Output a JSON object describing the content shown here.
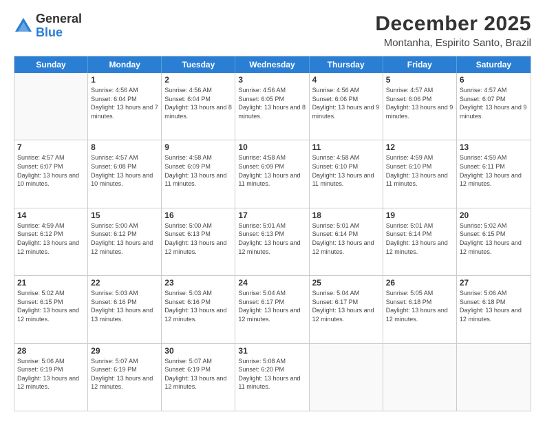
{
  "logo": {
    "general": "General",
    "blue": "Blue"
  },
  "header": {
    "month_year": "December 2025",
    "location": "Montanha, Espirito Santo, Brazil"
  },
  "weekdays": [
    "Sunday",
    "Monday",
    "Tuesday",
    "Wednesday",
    "Thursday",
    "Friday",
    "Saturday"
  ],
  "weeks": [
    [
      {
        "day": "",
        "sunrise": "",
        "sunset": "",
        "daylight": "",
        "empty": true
      },
      {
        "day": "1",
        "sunrise": "Sunrise: 4:56 AM",
        "sunset": "Sunset: 6:04 PM",
        "daylight": "Daylight: 13 hours and 7 minutes."
      },
      {
        "day": "2",
        "sunrise": "Sunrise: 4:56 AM",
        "sunset": "Sunset: 6:04 PM",
        "daylight": "Daylight: 13 hours and 8 minutes."
      },
      {
        "day": "3",
        "sunrise": "Sunrise: 4:56 AM",
        "sunset": "Sunset: 6:05 PM",
        "daylight": "Daylight: 13 hours and 8 minutes."
      },
      {
        "day": "4",
        "sunrise": "Sunrise: 4:56 AM",
        "sunset": "Sunset: 6:06 PM",
        "daylight": "Daylight: 13 hours and 9 minutes."
      },
      {
        "day": "5",
        "sunrise": "Sunrise: 4:57 AM",
        "sunset": "Sunset: 6:06 PM",
        "daylight": "Daylight: 13 hours and 9 minutes."
      },
      {
        "day": "6",
        "sunrise": "Sunrise: 4:57 AM",
        "sunset": "Sunset: 6:07 PM",
        "daylight": "Daylight: 13 hours and 9 minutes."
      }
    ],
    [
      {
        "day": "7",
        "sunrise": "Sunrise: 4:57 AM",
        "sunset": "Sunset: 6:07 PM",
        "daylight": "Daylight: 13 hours and 10 minutes."
      },
      {
        "day": "8",
        "sunrise": "Sunrise: 4:57 AM",
        "sunset": "Sunset: 6:08 PM",
        "daylight": "Daylight: 13 hours and 10 minutes."
      },
      {
        "day": "9",
        "sunrise": "Sunrise: 4:58 AM",
        "sunset": "Sunset: 6:09 PM",
        "daylight": "Daylight: 13 hours and 11 minutes."
      },
      {
        "day": "10",
        "sunrise": "Sunrise: 4:58 AM",
        "sunset": "Sunset: 6:09 PM",
        "daylight": "Daylight: 13 hours and 11 minutes."
      },
      {
        "day": "11",
        "sunrise": "Sunrise: 4:58 AM",
        "sunset": "Sunset: 6:10 PM",
        "daylight": "Daylight: 13 hours and 11 minutes."
      },
      {
        "day": "12",
        "sunrise": "Sunrise: 4:59 AM",
        "sunset": "Sunset: 6:10 PM",
        "daylight": "Daylight: 13 hours and 11 minutes."
      },
      {
        "day": "13",
        "sunrise": "Sunrise: 4:59 AM",
        "sunset": "Sunset: 6:11 PM",
        "daylight": "Daylight: 13 hours and 12 minutes."
      }
    ],
    [
      {
        "day": "14",
        "sunrise": "Sunrise: 4:59 AM",
        "sunset": "Sunset: 6:12 PM",
        "daylight": "Daylight: 13 hours and 12 minutes."
      },
      {
        "day": "15",
        "sunrise": "Sunrise: 5:00 AM",
        "sunset": "Sunset: 6:12 PM",
        "daylight": "Daylight: 13 hours and 12 minutes."
      },
      {
        "day": "16",
        "sunrise": "Sunrise: 5:00 AM",
        "sunset": "Sunset: 6:13 PM",
        "daylight": "Daylight: 13 hours and 12 minutes."
      },
      {
        "day": "17",
        "sunrise": "Sunrise: 5:01 AM",
        "sunset": "Sunset: 6:13 PM",
        "daylight": "Daylight: 13 hours and 12 minutes."
      },
      {
        "day": "18",
        "sunrise": "Sunrise: 5:01 AM",
        "sunset": "Sunset: 6:14 PM",
        "daylight": "Daylight: 13 hours and 12 minutes."
      },
      {
        "day": "19",
        "sunrise": "Sunrise: 5:01 AM",
        "sunset": "Sunset: 6:14 PM",
        "daylight": "Daylight: 13 hours and 12 minutes."
      },
      {
        "day": "20",
        "sunrise": "Sunrise: 5:02 AM",
        "sunset": "Sunset: 6:15 PM",
        "daylight": "Daylight: 13 hours and 12 minutes."
      }
    ],
    [
      {
        "day": "21",
        "sunrise": "Sunrise: 5:02 AM",
        "sunset": "Sunset: 6:15 PM",
        "daylight": "Daylight: 13 hours and 12 minutes."
      },
      {
        "day": "22",
        "sunrise": "Sunrise: 5:03 AM",
        "sunset": "Sunset: 6:16 PM",
        "daylight": "Daylight: 13 hours and 13 minutes."
      },
      {
        "day": "23",
        "sunrise": "Sunrise: 5:03 AM",
        "sunset": "Sunset: 6:16 PM",
        "daylight": "Daylight: 13 hours and 12 minutes."
      },
      {
        "day": "24",
        "sunrise": "Sunrise: 5:04 AM",
        "sunset": "Sunset: 6:17 PM",
        "daylight": "Daylight: 13 hours and 12 minutes."
      },
      {
        "day": "25",
        "sunrise": "Sunrise: 5:04 AM",
        "sunset": "Sunset: 6:17 PM",
        "daylight": "Daylight: 13 hours and 12 minutes."
      },
      {
        "day": "26",
        "sunrise": "Sunrise: 5:05 AM",
        "sunset": "Sunset: 6:18 PM",
        "daylight": "Daylight: 13 hours and 12 minutes."
      },
      {
        "day": "27",
        "sunrise": "Sunrise: 5:06 AM",
        "sunset": "Sunset: 6:18 PM",
        "daylight": "Daylight: 13 hours and 12 minutes."
      }
    ],
    [
      {
        "day": "28",
        "sunrise": "Sunrise: 5:06 AM",
        "sunset": "Sunset: 6:19 PM",
        "daylight": "Daylight: 13 hours and 12 minutes."
      },
      {
        "day": "29",
        "sunrise": "Sunrise: 5:07 AM",
        "sunset": "Sunset: 6:19 PM",
        "daylight": "Daylight: 13 hours and 12 minutes."
      },
      {
        "day": "30",
        "sunrise": "Sunrise: 5:07 AM",
        "sunset": "Sunset: 6:19 PM",
        "daylight": "Daylight: 13 hours and 12 minutes."
      },
      {
        "day": "31",
        "sunrise": "Sunrise: 5:08 AM",
        "sunset": "Sunset: 6:20 PM",
        "daylight": "Daylight: 13 hours and 11 minutes."
      },
      {
        "day": "",
        "sunrise": "",
        "sunset": "",
        "daylight": "",
        "empty": true
      },
      {
        "day": "",
        "sunrise": "",
        "sunset": "",
        "daylight": "",
        "empty": true
      },
      {
        "day": "",
        "sunrise": "",
        "sunset": "",
        "daylight": "",
        "empty": true
      }
    ]
  ]
}
